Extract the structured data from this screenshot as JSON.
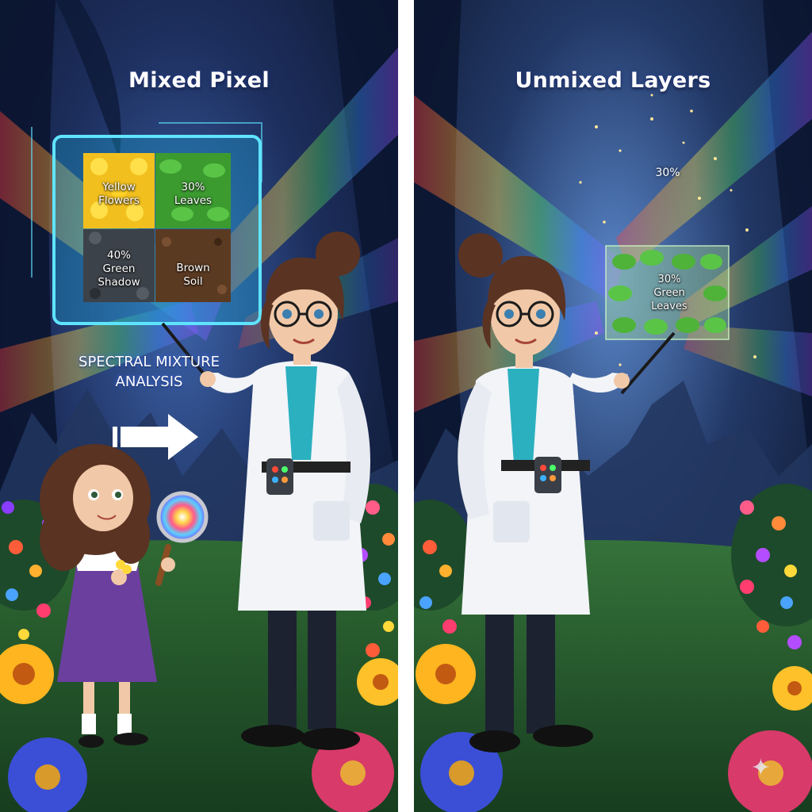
{
  "left_panel": {
    "title": "Mixed Pixel",
    "cells": [
      {
        "label": "Yellow\nFlowers"
      },
      {
        "label": "30%\nLeaves"
      },
      {
        "label": "40%\nGreen\nShadow"
      },
      {
        "label": "Brown\nSoil"
      }
    ],
    "caption": "SPECTRAL MIXTURE\nANALYSIS"
  },
  "right_panel": {
    "title": "Unmixed Layers",
    "floating_percent": "30%",
    "layer_label": "30%\nGreen\nLeaves"
  },
  "colors": {
    "background_night": "#13234a",
    "glow_cyan": "#37d8ff",
    "lab_coat": "#f2f4f8",
    "hair_brown": "#5a3322",
    "dress_purple": "#6b3f9e"
  },
  "icons": {
    "arrow": "right-arrow-icon",
    "magnifier": "magnifying-glass-icon",
    "sparkle": "sparkle-icon"
  }
}
